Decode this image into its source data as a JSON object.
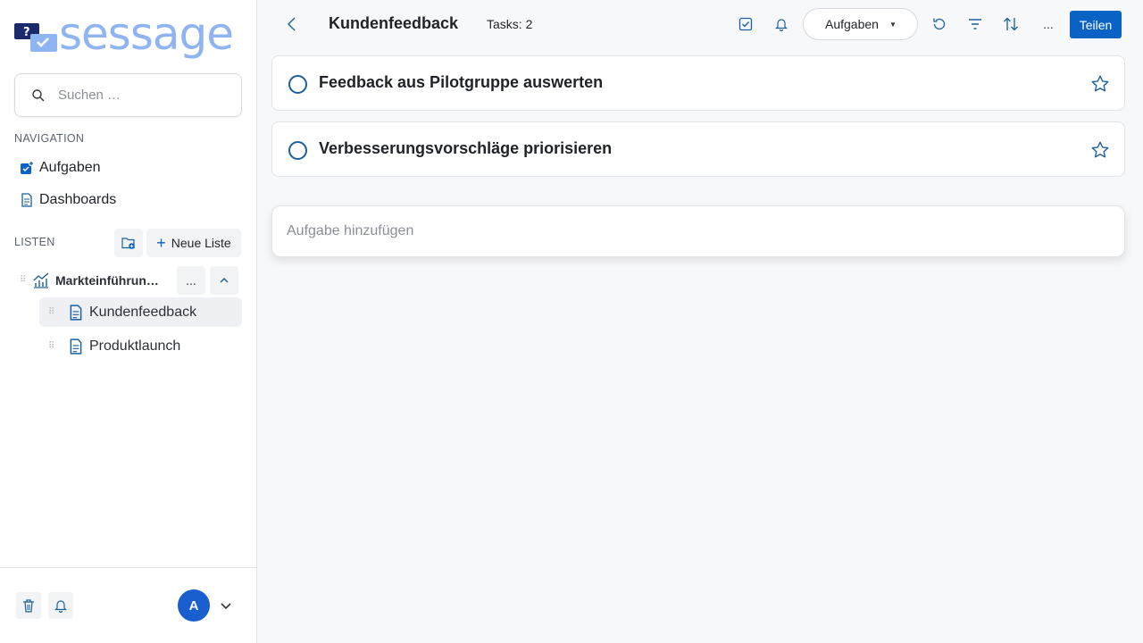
{
  "app": {
    "logo_text": "sessage"
  },
  "search": {
    "placeholder": "Suchen …"
  },
  "navigation": {
    "label": "NAVIGATION",
    "items": [
      {
        "label": "Aufgaben",
        "icon": "tasks-add-icon"
      },
      {
        "label": "Dashboards",
        "icon": "document-icon"
      }
    ]
  },
  "lists": {
    "label": "LISTEN",
    "new_list_label": "Neue Liste",
    "group": {
      "title": "Markteinführun…",
      "more_label": "...",
      "children": [
        {
          "label": "Kundenfeedback",
          "active": true
        },
        {
          "label": "Produktlaunch",
          "active": false
        }
      ]
    }
  },
  "user": {
    "avatar_initial": "A"
  },
  "header": {
    "title": "Kundenfeedback",
    "task_count": "Tasks: 2",
    "view_select": "Aufgaben",
    "more_label": "...",
    "share_label": "Teilen"
  },
  "tasks": [
    {
      "title": "Feedback aus Pilotgruppe auswerten",
      "starred": false
    },
    {
      "title": "Verbesserungsvorschläge priorisieren",
      "starred": false
    }
  ],
  "add_task": {
    "placeholder": "Aufgabe hinzufügen"
  },
  "colors": {
    "accent": "#0a62c4",
    "logo": "#8fb4f2",
    "avatar": "#1a5fd0"
  }
}
